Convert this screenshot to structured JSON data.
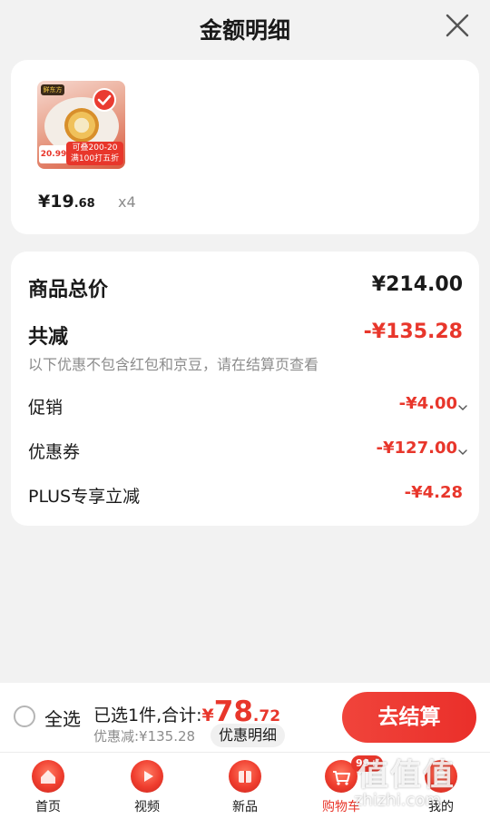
{
  "header": {
    "title": "金额明细"
  },
  "product": {
    "thumb_logo": "鲜东方",
    "thumb_promo_line1": "可叠200-20",
    "thumb_promo_line2": "满100打五折",
    "thumb_price": "20.99",
    "price_symbol": "¥",
    "price_int": "19",
    "price_dec": ".68",
    "quantity": "x4"
  },
  "summary": {
    "total_label": "商品总价",
    "total_value": "¥214.00",
    "reduce_label": "共减",
    "reduce_value": "-¥135.28",
    "hint": "以下优惠不包含红包和京豆，请在结算页查看",
    "promo_label": "促销",
    "promo_value": "-¥4.00",
    "coupon_label": "优惠券",
    "coupon_value": "-¥127.00",
    "plus_label": "PLUS专享立减",
    "plus_value": "-¥4.28"
  },
  "checkout": {
    "select_all": "全选",
    "selected_text": "已选1件,合计:",
    "currency": "¥",
    "amount_int": "78",
    "amount_dec": ".72",
    "discount_text": "优惠减:¥135.28",
    "detail_button": "优惠明细",
    "checkout_button": "去结算"
  },
  "nav": {
    "items": [
      {
        "label": "首页",
        "icon": "home-icon"
      },
      {
        "label": "视频",
        "icon": "video-icon"
      },
      {
        "label": "新品",
        "icon": "new-products-icon"
      },
      {
        "label": "购物车",
        "icon": "cart-icon",
        "badge": "99+",
        "active": true
      },
      {
        "label": "我的",
        "icon": "profile-icon"
      }
    ]
  },
  "colors": {
    "accent": "#e8362b",
    "background": "#f2f2f2",
    "card": "#ffffff"
  },
  "watermark": {
    "mark": "值值值",
    "text": "zhizhi.com"
  }
}
